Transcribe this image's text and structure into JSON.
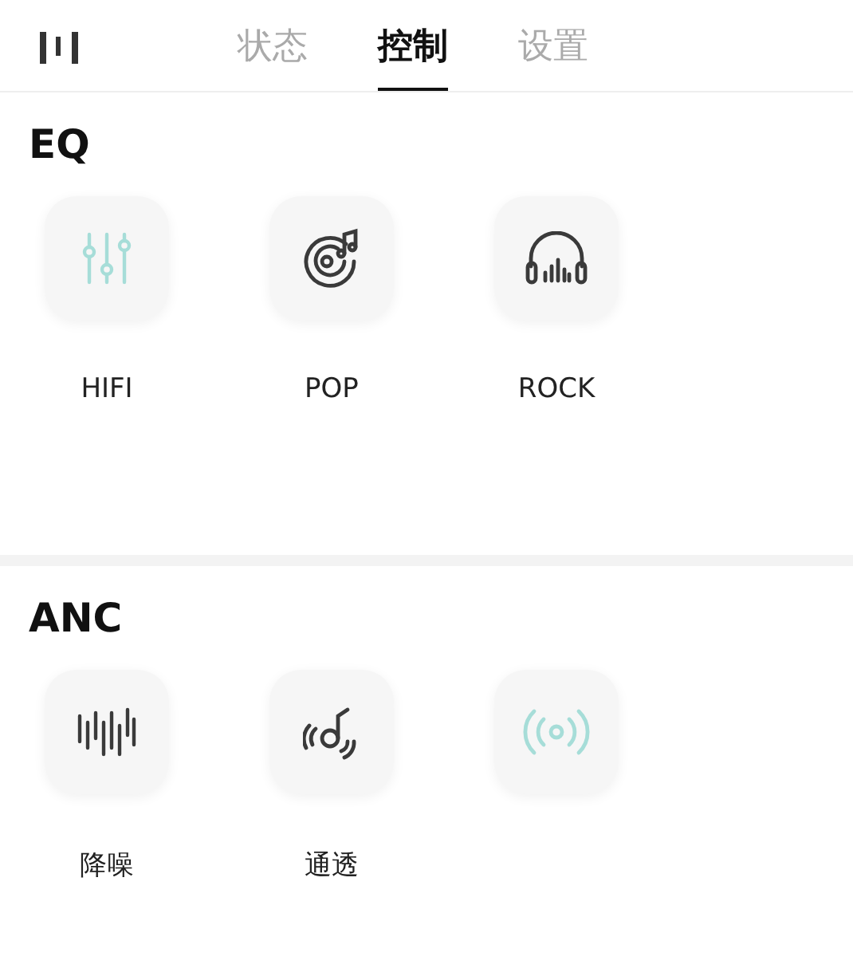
{
  "tabs": [
    {
      "label": "状态",
      "selected": false
    },
    {
      "label": "控制",
      "selected": true
    },
    {
      "label": "设置",
      "selected": false
    }
  ],
  "sections": [
    {
      "title": "EQ",
      "items": [
        {
          "label": "HIFI",
          "selected": true
        },
        {
          "label": "POP",
          "selected": false
        },
        {
          "label": "ROCK",
          "selected": false
        }
      ]
    },
    {
      "title": "ANC",
      "items": [
        {
          "label": "降噪",
          "selected": false
        },
        {
          "label": "通透",
          "selected": false
        },
        {
          "selected": true
        }
      ]
    }
  ]
}
